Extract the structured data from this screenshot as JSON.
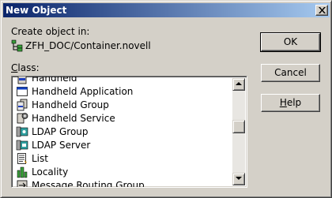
{
  "window": {
    "title": "New Object"
  },
  "create_in": {
    "label": "Create object in:",
    "path": "ZFH_DOC/Container.novell"
  },
  "class_list": {
    "label_underlined": "C",
    "label_rest": "lass:",
    "items": [
      {
        "label": "Handheld",
        "icon": "handheld-icon"
      },
      {
        "label": "Handheld Application",
        "icon": "application-window-icon"
      },
      {
        "label": "Handheld Group",
        "icon": "handheld-group-icon"
      },
      {
        "label": "Handheld Service",
        "icon": "handheld-service-icon"
      },
      {
        "label": "LDAP Group",
        "icon": "ldap-group-icon"
      },
      {
        "label": "LDAP Server",
        "icon": "ldap-server-icon"
      },
      {
        "label": "List",
        "icon": "list-icon"
      },
      {
        "label": "Locality",
        "icon": "locality-icon"
      },
      {
        "label": "Message Routing Group",
        "icon": "message-routing-icon"
      }
    ]
  },
  "buttons": {
    "ok": "OK",
    "cancel": "Cancel",
    "help_underlined": "H",
    "help_rest": "elp"
  }
}
